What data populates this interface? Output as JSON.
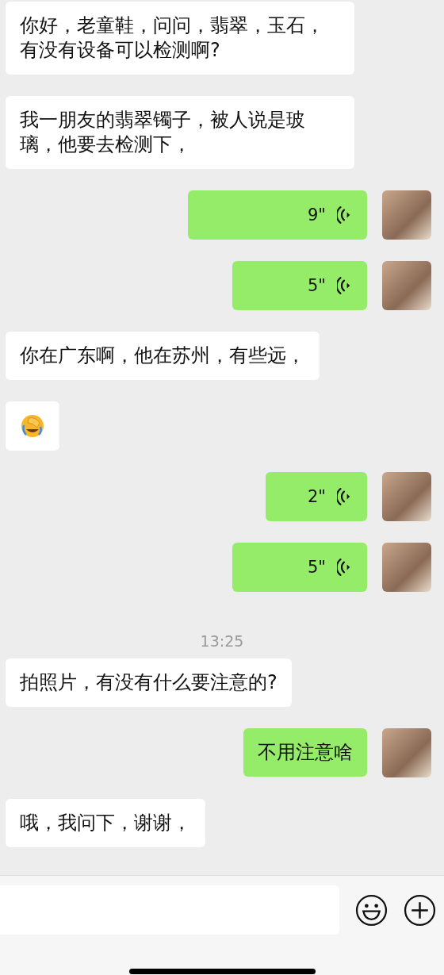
{
  "messages": [
    {
      "kind": "text",
      "outgoing": false,
      "text": "你好，老童鞋，问问，翡翠，玉石，有没有设备可以检测啊?"
    },
    {
      "kind": "text",
      "outgoing": false,
      "text": "我一朋友的翡翠镯子，被人说是玻璃，他要去检测下，"
    },
    {
      "kind": "voice",
      "outgoing": true,
      "duration": "9\""
    },
    {
      "kind": "voice",
      "outgoing": true,
      "duration": "5\""
    },
    {
      "kind": "text",
      "outgoing": false,
      "text": "你在广东啊，他在苏州，有些远，"
    },
    {
      "kind": "sticker",
      "outgoing": false
    },
    {
      "kind": "voice",
      "outgoing": true,
      "duration": "2\""
    },
    {
      "kind": "voice",
      "outgoing": true,
      "duration": "5\""
    },
    {
      "kind": "time",
      "text": "13:25"
    },
    {
      "kind": "text",
      "outgoing": false,
      "text": "拍照片，有没有什么要注意的?"
    },
    {
      "kind": "text",
      "outgoing": true,
      "text": "不用注意啥"
    },
    {
      "kind": "text",
      "outgoing": false,
      "text": "哦，我问下，谢谢，"
    }
  ]
}
